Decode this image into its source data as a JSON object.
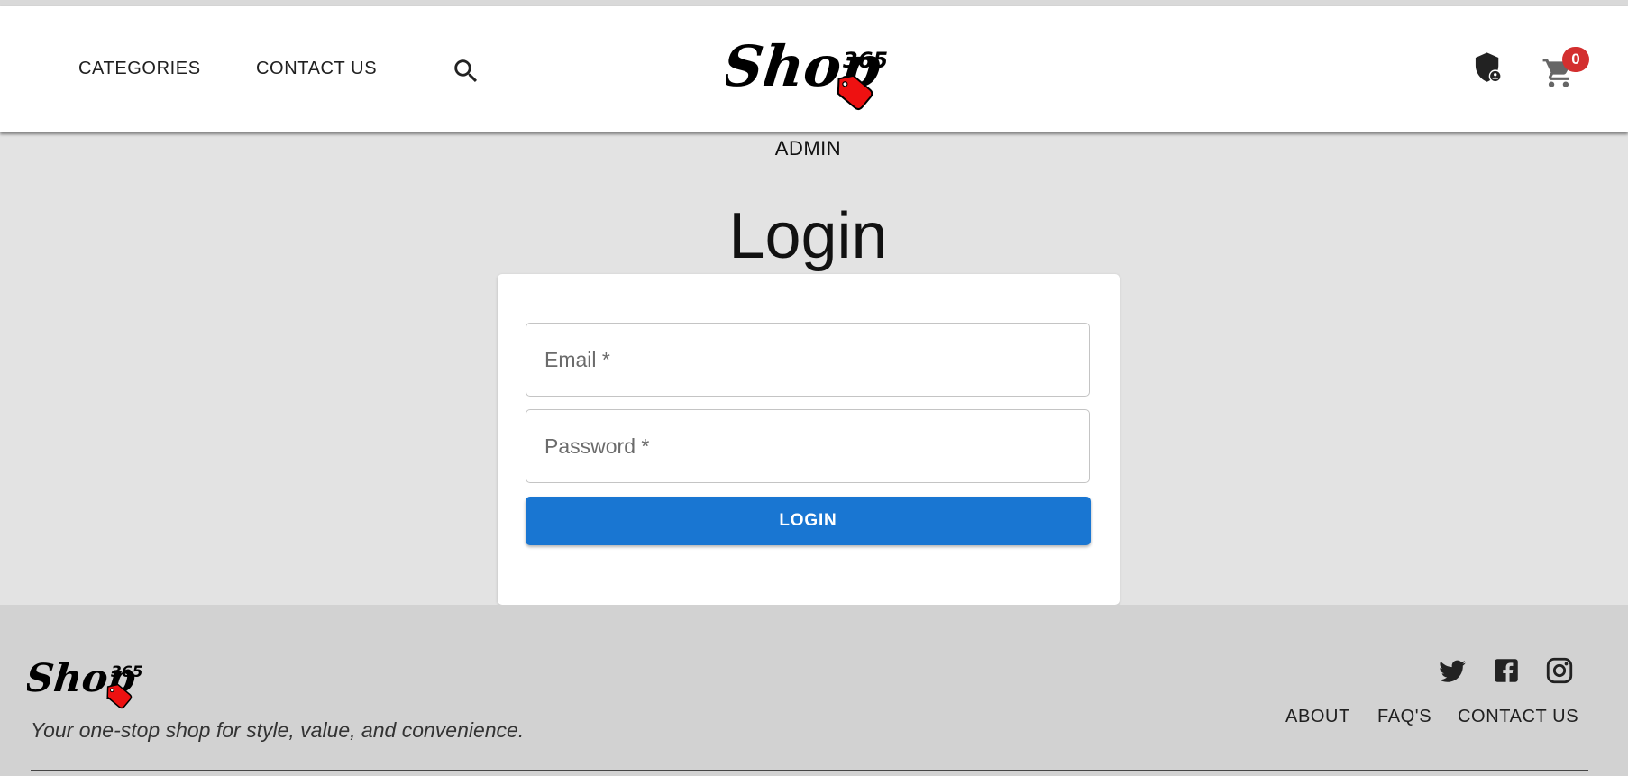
{
  "header": {
    "nav": [
      {
        "label": "CATEGORIES"
      },
      {
        "label": "CONTACT US"
      }
    ],
    "search_icon": "search-icon",
    "logo_icon": "shop365-logo",
    "admin_icon": "admin-shield-icon",
    "cart_icon": "shopping-cart-icon",
    "cart_count": "0"
  },
  "main": {
    "section_label": "ADMIN",
    "title": "Login",
    "form": {
      "email_placeholder": "Email *",
      "email_value": "",
      "password_placeholder": "Password *",
      "password_value": "",
      "submit_label": "LOGIN"
    }
  },
  "footer": {
    "tagline": "Your one-stop shop for style, value, and convenience.",
    "social": [
      {
        "icon": "twitter-icon"
      },
      {
        "icon": "facebook-icon"
      },
      {
        "icon": "instagram-icon"
      }
    ],
    "links": [
      {
        "label": "ABOUT"
      },
      {
        "label": "FAQ'S"
      },
      {
        "label": "CONTACT US"
      }
    ]
  },
  "colors": {
    "primary": "#1976d2",
    "badge": "#d32f2f",
    "tag_red": "#ee1111",
    "page_bg": "#e3e3e3",
    "footer_bg": "#d2d2d2"
  }
}
